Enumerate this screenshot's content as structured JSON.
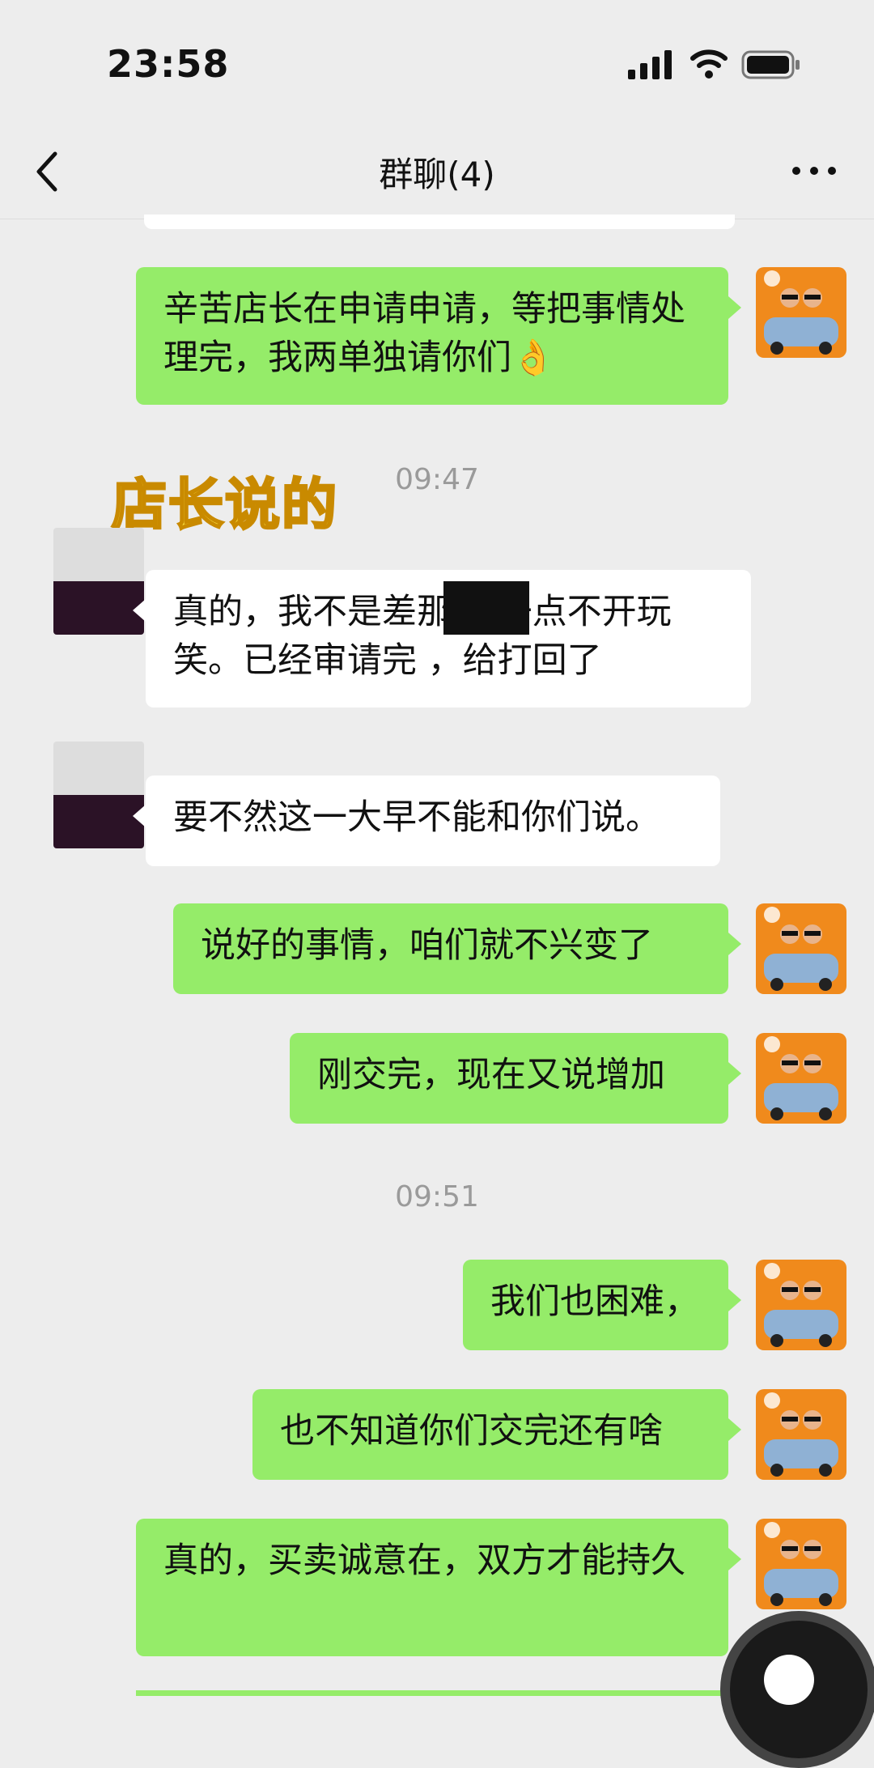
{
  "status": {
    "time": "23:58"
  },
  "nav": {
    "title": "群聊(4)"
  },
  "sticker_text": "店长说的",
  "messages": [
    {
      "from": "me",
      "text": "辛苦店长在申请申请，等把事情处理完，我两单独请你们👌"
    },
    {
      "from": "them",
      "text": "真的，我不是差那 ，一点不开玩笑。已经审请完 ，给打回了"
    },
    {
      "from": "them",
      "text": "要不然这一大早不能和你们说。"
    },
    {
      "from": "me",
      "text": "说好的事情，咱们就不兴变了"
    },
    {
      "from": "me",
      "text": "刚交完，现在又说增加"
    },
    {
      "from": "me",
      "text": "我们也困难，"
    },
    {
      "from": "me",
      "text": "也不知道你们交完还有啥"
    },
    {
      "from": "me",
      "text": "真的，买卖诚意在，双方才能持久"
    }
  ],
  "timestamps": [
    "09:47",
    "09:51"
  ],
  "colors": {
    "bg": "#ededed",
    "me_bubble": "#95ec69",
    "them_bubble": "#ffffff"
  }
}
